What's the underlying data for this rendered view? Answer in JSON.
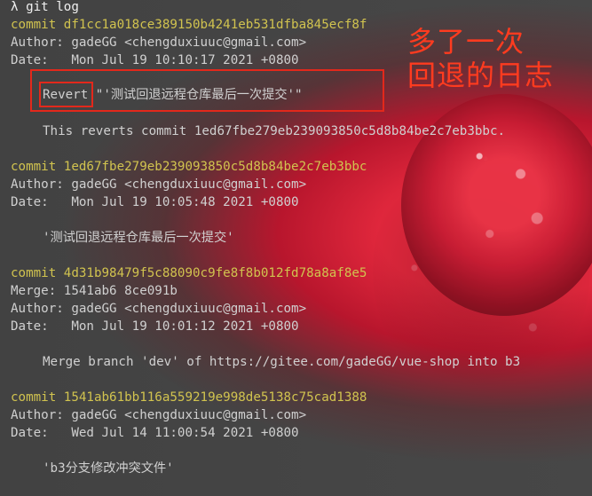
{
  "terminal": {
    "prompt": "λ git log",
    "lines": [
      "commit df1cc1a018ce389150b4241eb531dfba845ecf8f",
      "Author: gadeGG <chengduxiuuc@gmail.com>",
      "Date:   Mon Jul 19 10:10:17 2021 +0800",
      "Revert \"'测试回退远程仓库最后一次提交'\"",
      "This reverts commit 1ed67fbe279eb239093850c5d8b84be2c7eb3bbc.",
      "commit 1ed67fbe279eb239093850c5d8b84be2c7eb3bbc",
      "Author: gadeGG <chengduxiuuc@gmail.com>",
      "Date:   Mon Jul 19 10:05:48 2021 +0800",
      "'测试回退远程仓库最后一次提交'",
      "commit 4d31b98479f5c88090c9fe8f8b012fd78a8af8e5",
      "Merge: 1541ab6 8ce091b",
      "Author: gadeGG <chengduxiuuc@gmail.com>",
      "Date:   Mon Jul 19 10:01:12 2021 +0800",
      "Merge branch 'dev' of https://gitee.com/gadeGG/vue-shop into b3",
      "commit 1541ab61bb116a559219e998de5138c75cad1388",
      "Author: gadeGG <chengduxiuuc@gmail.com>",
      "Date:   Wed Jul 14 11:00:54 2021 +0800",
      "'b3分支修改冲突文件'"
    ]
  },
  "annotation": {
    "line1": "多了一次",
    "line2": "回退的日志"
  },
  "colors": {
    "accent": "#e3281b",
    "commit": "#d1c34f",
    "text": "#d0d0d0"
  }
}
